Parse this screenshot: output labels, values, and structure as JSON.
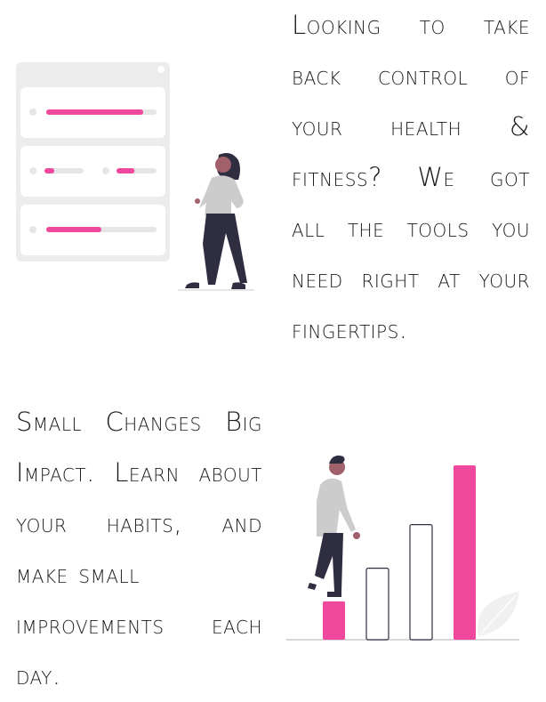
{
  "section_health": {
    "lines": [
      "Looking to take",
      "back control of",
      "your health &",
      "fitness? We got",
      "all the tools you",
      "need right at your",
      "fingertips."
    ]
  },
  "section_habits": {
    "lines": [
      "Small Changes Big",
      "Impact. Learn about",
      "your habits, and",
      "make small",
      "improvements each",
      "day."
    ]
  },
  "colors": {
    "accent": "#f0489c",
    "card_bg": "#ececec",
    "bar_track": "#e6e6e6",
    "dark": "#2f2e41",
    "shirt": "#cccccc",
    "skin": "#a0616a"
  },
  "progress_card": {
    "bars": [
      0.88,
      0.25,
      0.45,
      0.5
    ]
  },
  "growth_chart": {
    "columns": [
      0.22,
      0.41,
      0.66,
      1.0
    ]
  }
}
